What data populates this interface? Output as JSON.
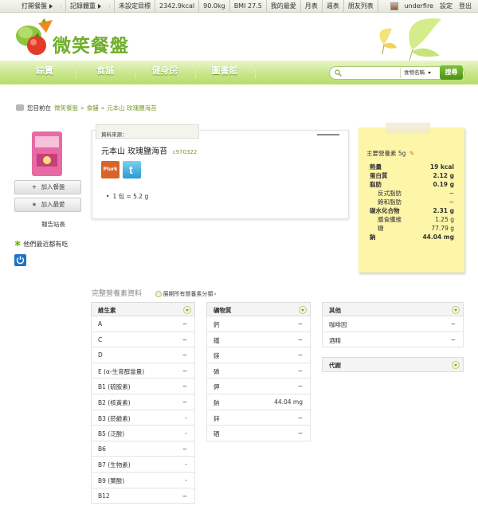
{
  "topbar": {
    "left": [
      "打開餐盤",
      "記錄體重",
      "未設定目標",
      "2342.9kcal",
      "90.0kg",
      "BMI 27.5",
      "我的最愛",
      "月表",
      "週表",
      "朋友列表"
    ],
    "username": "underfire",
    "settings": "設定",
    "logout": "登出"
  },
  "logo_text": "微笑餐盤",
  "nav": [
    "綜覽",
    "食舖",
    "健身房",
    "圖書館"
  ],
  "search": {
    "placeholder": "",
    "category": "食物名稱",
    "button": "搜尋"
  },
  "breadcrumb": {
    "prefix": "您目前在",
    "items": [
      "微笑餐盤",
      "食舖",
      "元本山 玫瑰鹽海苔"
    ],
    "sep": "»"
  },
  "left": {
    "add_meal": "加入餐盤",
    "add_fav": "加入最愛",
    "report": "報告站長",
    "recent_title": "他們最近都有吃"
  },
  "product": {
    "source_label": "資料來源：",
    "name": "元本山 玫瑰鹽海苔",
    "code": "c970322",
    "plurk": "Plurk",
    "serving": "1 包 = 5.2 g"
  },
  "nutrients": {
    "title": "主要營養素 5g",
    "rows": [
      {
        "name": "熱量",
        "value": "19 kcal",
        "bold": true,
        "indent": false
      },
      {
        "name": "蛋白質",
        "value": "2.12 g",
        "bold": true,
        "indent": false
      },
      {
        "name": "脂肪",
        "value": "0.19 g",
        "bold": true,
        "indent": false
      },
      {
        "name": "反式脂肪",
        "value": "~",
        "bold": false,
        "indent": true
      },
      {
        "name": "飽和脂肪",
        "value": "~",
        "bold": false,
        "indent": true
      },
      {
        "name": "碳水化合物",
        "value": "2.31 g",
        "bold": true,
        "indent": false
      },
      {
        "name": "膳食纖維",
        "value": "1.25 g",
        "bold": false,
        "indent": true
      },
      {
        "name": "糖",
        "value": "77.79 g",
        "bold": false,
        "indent": true
      },
      {
        "name": "鈉",
        "value": "44.04 mg",
        "bold": true,
        "indent": false
      }
    ]
  },
  "full_info": {
    "title": "完整營養素資料",
    "expand": "展開所有營養素分類"
  },
  "vitamins": {
    "title": "維生素",
    "rows": [
      {
        "name": "A",
        "value": "~"
      },
      {
        "name": "C",
        "value": "~"
      },
      {
        "name": "D",
        "value": "~"
      },
      {
        "name": "E (α-生育醇當量)",
        "value": "~"
      },
      {
        "name": "B1 (硫胺素)",
        "value": "~"
      },
      {
        "name": "B2 (核黃素)",
        "value": "~"
      },
      {
        "name": "B3 (菸鹼素)",
        "value": "-"
      },
      {
        "name": "B5 (泛酸)",
        "value": "-"
      },
      {
        "name": "B6",
        "value": "~"
      },
      {
        "name": "B7 (生物素)",
        "value": "-"
      },
      {
        "name": "B9 (葉酸)",
        "value": "-"
      },
      {
        "name": "B12",
        "value": "~"
      }
    ]
  },
  "minerals": {
    "title": "礦物質",
    "rows": [
      {
        "name": "鈣",
        "value": "~"
      },
      {
        "name": "鐵",
        "value": "~"
      },
      {
        "name": "鎂",
        "value": "~"
      },
      {
        "name": "磷",
        "value": "~"
      },
      {
        "name": "鉀",
        "value": "~"
      },
      {
        "name": "鈉",
        "value": "44.04 mg"
      },
      {
        "name": "鋅",
        "value": "~"
      },
      {
        "name": "硒",
        "value": "~"
      }
    ]
  },
  "others": {
    "title": "其他",
    "rows": [
      {
        "name": "咖啡因",
        "value": "~"
      },
      {
        "name": "酒精",
        "value": "~"
      }
    ]
  },
  "metabolism": {
    "title": "代謝"
  }
}
